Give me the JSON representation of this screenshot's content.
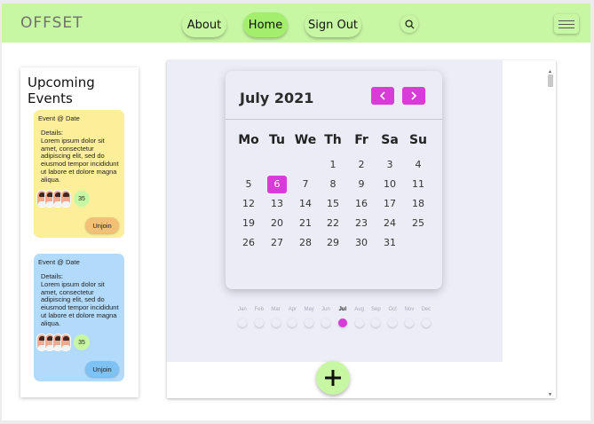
{
  "app": {
    "logo": "OFFSET"
  },
  "nav": {
    "about": "About",
    "home": "Home",
    "signout": "Sign Out",
    "search_icon": "search-icon",
    "menu_icon": "hamburger-menu-icon"
  },
  "events": {
    "title": "Upcoming Events",
    "cards": [
      {
        "title": "Event @ Date",
        "details_label": "Details:",
        "details": "Lorem ipsum dolor sit amet, consectetur adipiscing elit, sed do eiusmod tempor incididunt ut labore et dolore magna aliqua.",
        "count": "35",
        "action": "Unjoin",
        "color": "#fdef99",
        "button_color": "#f3c078"
      },
      {
        "title": "Event @ Date",
        "details_label": "Details:",
        "details": "Lorem ipsum dolor sit amet, consectetur adipiscing elit, sed do eiusmod tempor incididunt ut labore et dolore magna aliqua.",
        "count": "35",
        "action": "Unjoin",
        "color": "#b2dbfb",
        "button_color": "#7ec1f3"
      }
    ]
  },
  "calendar": {
    "month_label": "July 2021",
    "prev_icon": "chevron-left-icon",
    "next_icon": "chevron-right-icon",
    "weekdays": [
      "Mo",
      "Tu",
      "We",
      "Th",
      "Fr",
      "Sa",
      "Su"
    ],
    "days": [
      "1",
      "2",
      "3",
      "4",
      "5",
      "6",
      "7",
      "8",
      "9",
      "10",
      "11",
      "12",
      "13",
      "14",
      "15",
      "16",
      "17",
      "18",
      "19",
      "20",
      "21",
      "22",
      "23",
      "24",
      "25",
      "26",
      "27",
      "28",
      "29",
      "30",
      "31"
    ],
    "today": "6",
    "accent_color": "#d83bd8"
  },
  "timeline": {
    "months": [
      "Jan",
      "Feb",
      "Mar",
      "Apr",
      "May",
      "Jun",
      "Jul",
      "Aug",
      "Sep",
      "Oct",
      "Nov",
      "Dec"
    ],
    "active": "Jul"
  },
  "add_button": {
    "icon": "plus-icon"
  }
}
